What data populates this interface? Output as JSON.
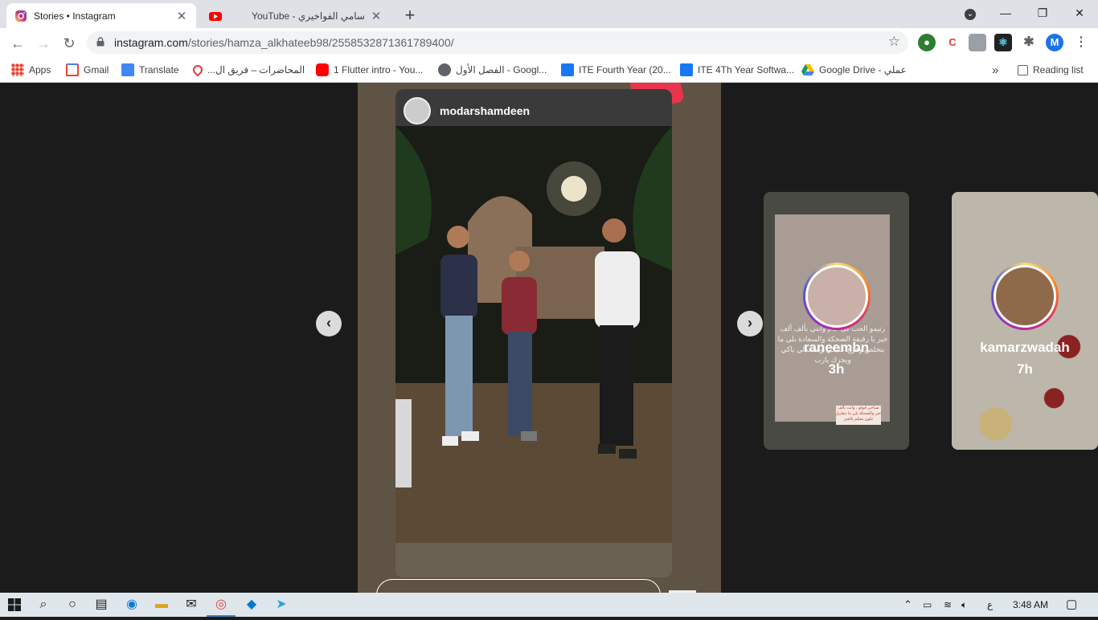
{
  "tabs": [
    {
      "title": "Stories • Instagram",
      "active": true
    },
    {
      "title": "سامي الفواخيري - YouTube",
      "active": false
    }
  ],
  "window_controls": {
    "minimize": "—",
    "maximize": "❐",
    "close": "✕",
    "tab_search": "⌄",
    "new_tab": "+"
  },
  "toolbar": {
    "back": "←",
    "forward": "→",
    "reload": "↻",
    "url_host": "instagram.com",
    "url_path": "/stories/hamza_alkhateeb98/2558532871361789400/",
    "profile_initial": "M"
  },
  "bookmarks": [
    {
      "label": "Apps",
      "icon": "apps-grid-icon"
    },
    {
      "label": "Gmail",
      "icon": "gmail-icon"
    },
    {
      "label": "Translate",
      "icon": "translate-icon"
    },
    {
      "label": "المحاضرات – فريق ال...",
      "icon": "drop-icon"
    },
    {
      "label": "1 Flutter intro - You...",
      "icon": "youtube-icon"
    },
    {
      "label": "الفصل الأول - Googl...",
      "icon": "globe-icon"
    },
    {
      "label": "ITE Fourth Year (20...",
      "icon": "facebook-icon"
    },
    {
      "label": "ITE 4Th Year Softwa...",
      "icon": "facebook-icon"
    },
    {
      "label": "Google Drive - عملي",
      "icon": "drive-icon"
    }
  ],
  "bookmarks_more": "»",
  "reading_list": "Reading list",
  "story": {
    "username": "modarshamdeen"
  },
  "previews": [
    {
      "username": "raneembn",
      "time": "3h",
      "caption": "رتيمو الحب كل عام وانتي بألف ألف خير يا رفيقة الضحكة والسعادة بلي ما بتخلص وفرح عليكي ويسعدلي ياكي ويجزك يارب",
      "sticker": "صباحي فوفو ، وانت بألف خير والضحكة يلي ما بتفارق تكون معكم بالخير"
    },
    {
      "username": "kamarzwadah",
      "time": "7h"
    }
  ],
  "taskbar": {
    "time": "3:48 AM",
    "lang": "ع"
  },
  "colors": {
    "instagram_ring": "#d62976",
    "chrome_tab_bg": "#dee1e6",
    "viewer_bg": "#1b1b1b",
    "profile_blue": "#1a73e8"
  }
}
